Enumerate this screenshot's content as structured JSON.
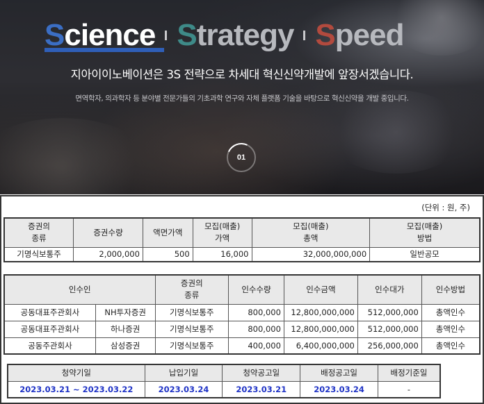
{
  "hero": {
    "words": [
      {
        "cap": "S",
        "rest": "cience"
      },
      {
        "cap": "S",
        "rest": "trategy"
      },
      {
        "cap": "S",
        "rest": "peed"
      }
    ],
    "tagline": "지아이이노베이션은 3S 전략으로 차세대 혁신신약개발에 앞장서겠습니다.",
    "description": "면역학자, 의과학자 등 분야별 전문가들의 기초과학 연구와 자체 플랫폼 기술을 바탕으로 혁신신약을 개발 중입니다.",
    "slide_number": "01",
    "colors": {
      "science": "#3b6ec4",
      "strategy": "#3e8a88",
      "speed": "#b24a3e"
    }
  },
  "document": {
    "unit_note": "(단위 : 원, 주)",
    "offering": {
      "headers": [
        [
          "증권의",
          "종류"
        ],
        [
          "증권수량",
          ""
        ],
        [
          "액면가액",
          ""
        ],
        [
          "모집(매출)",
          "가액"
        ],
        [
          "모집(매출)",
          "총액"
        ],
        [
          "모집(매출)",
          "방법"
        ]
      ],
      "row": [
        "기명식보통주",
        "2,000,000",
        "500",
        "16,000",
        "32,000,000,000",
        "일반공모"
      ]
    },
    "underwriters": {
      "headers": [
        [
          "인수인",
          ""
        ],
        [
          "증권의",
          "종류"
        ],
        [
          "인수수량",
          ""
        ],
        [
          "인수금액",
          ""
        ],
        [
          "인수대가",
          ""
        ],
        [
          "인수방법",
          ""
        ]
      ],
      "rows": [
        [
          "공동대표주관회사",
          "NH투자증권",
          "기명식보통주",
          "800,000",
          "12,800,000,000",
          "512,000,000",
          "총액인수"
        ],
        [
          "공동대표주관회사",
          "하나증권",
          "기명식보통주",
          "800,000",
          "12,800,000,000",
          "512,000,000",
          "총액인수"
        ],
        [
          "공동주관회사",
          "삼성증권",
          "기명식보통주",
          "400,000",
          "6,400,000,000",
          "256,000,000",
          "총액인수"
        ]
      ]
    },
    "schedule": {
      "headers": [
        "청약기일",
        "납입기일",
        "청약공고일",
        "배정공고일",
        "배정기준일"
      ],
      "row": [
        "2023.03.21 ~ 2023.03.22",
        "2023.03.24",
        "2023.03.21",
        "2023.03.24",
        "-"
      ]
    }
  }
}
